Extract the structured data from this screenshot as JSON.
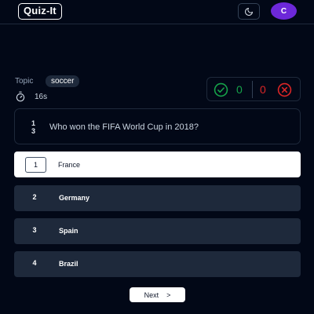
{
  "header": {
    "logo": "Quiz-It",
    "avatar_initial": "C"
  },
  "quiz": {
    "topic_label": "Topic",
    "topic": "soccer",
    "timer": "16s",
    "correct_count": "0",
    "wrong_count": "0",
    "question_number": "1",
    "question_total": "3",
    "question": "Who won the FIFA World Cup in 2018?",
    "options": [
      {
        "number": "1",
        "label": "France",
        "selected": true
      },
      {
        "number": "2",
        "label": "Germany",
        "selected": false
      },
      {
        "number": "3",
        "label": "Spain",
        "selected": false
      },
      {
        "number": "4",
        "label": "Brazil",
        "selected": false
      }
    ],
    "next_label": "Next",
    "next_arrow": ">"
  },
  "colors": {
    "background": "#020817",
    "avatar": "#6d28d9",
    "correct": "#16a34a",
    "wrong": "#dc2626",
    "option_bg": "#1e293b"
  },
  "icons": {
    "theme": "moon-icon",
    "timer": "stopwatch-icon",
    "correct": "check-circle-icon",
    "wrong": "x-circle-icon"
  }
}
